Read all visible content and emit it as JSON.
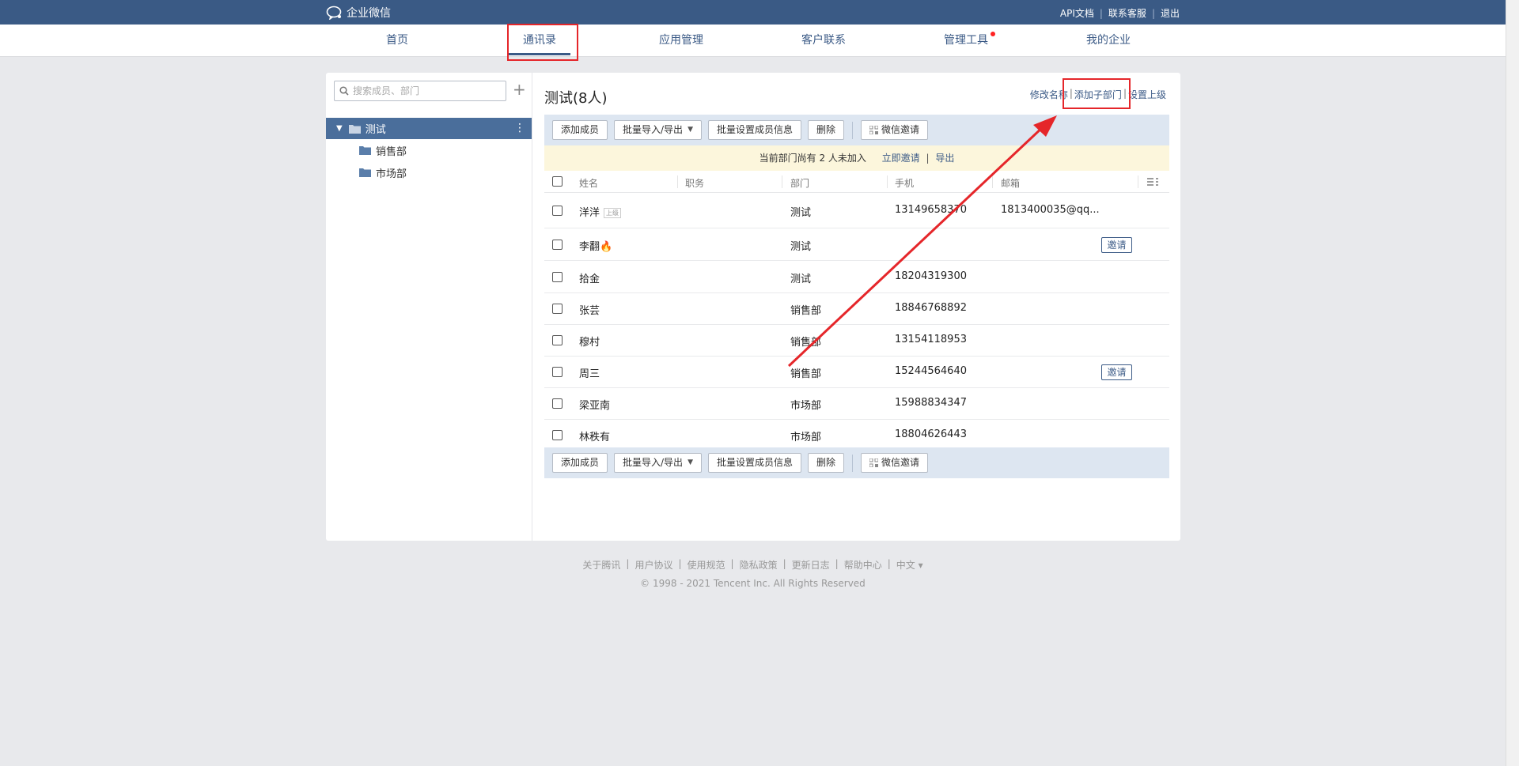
{
  "topbar": {
    "logo_text": "企业微信",
    "links": [
      "API文档",
      "联系客服",
      "退出"
    ]
  },
  "nav": {
    "tabs": [
      "首页",
      "通讯录",
      "应用管理",
      "客户联系",
      "管理工具",
      "我的企业"
    ],
    "active": "通讯录"
  },
  "sidebar": {
    "search_placeholder": "搜索成员、部门",
    "root": "测试",
    "children": [
      "销售部",
      "市场部"
    ]
  },
  "main": {
    "title": "测试(8人)",
    "actions": [
      "修改名称",
      "添加子部门",
      "设置上级"
    ],
    "toolbar": {
      "add_member": "添加成员",
      "import_export": "批量导入/导出",
      "batch_set": "批量设置成员信息",
      "delete": "删除",
      "wechat_invite": "微信邀请"
    },
    "notice": {
      "text": "当前部门尚有 2 人未加入",
      "invite_now": "立即邀请",
      "export": "导出"
    },
    "columns": [
      "姓名",
      "职务",
      "部门",
      "手机",
      "邮箱"
    ],
    "rows": [
      {
        "name": "洋洋",
        "tag": "上级",
        "dept": "测试",
        "phone": "13149658370",
        "email": "1813400035@qq...",
        "invite": ""
      },
      {
        "name": "李翻🔥",
        "tag": "",
        "dept": "测试",
        "phone": "",
        "email": "",
        "invite": "邀请"
      },
      {
        "name": "拾金",
        "tag": "",
        "dept": "测试",
        "phone": "18204319300",
        "email": "",
        "invite": ""
      },
      {
        "name": "张芸",
        "tag": "",
        "dept": "销售部",
        "phone": "18846768892",
        "email": "",
        "invite": ""
      },
      {
        "name": "穆村",
        "tag": "",
        "dept": "销售部",
        "phone": "13154118953",
        "email": "",
        "invite": ""
      },
      {
        "name": "周三",
        "tag": "",
        "dept": "销售部",
        "phone": "15244564640",
        "email": "",
        "invite": "邀请"
      },
      {
        "name": "梁亚南",
        "tag": "",
        "dept": "市场部",
        "phone": "15988834347",
        "email": "",
        "invite": ""
      },
      {
        "name": "林秩有",
        "tag": "",
        "dept": "市场部",
        "phone": "18804626443",
        "email": "",
        "invite": ""
      }
    ]
  },
  "footer": {
    "links": [
      "关于腾讯",
      "用户协议",
      "使用规范",
      "隐私政策",
      "更新日志",
      "帮助中心",
      "中文 ▾"
    ],
    "copyright": "© 1998 - 2021 Tencent Inc. All Rights Reserved"
  },
  "colors": {
    "topbar": "#3a5a85",
    "accent": "#3b5a86",
    "annotation": "#e5262a",
    "notice_bg": "#fcf6dc",
    "toolbar_bg": "#dde6f1"
  }
}
